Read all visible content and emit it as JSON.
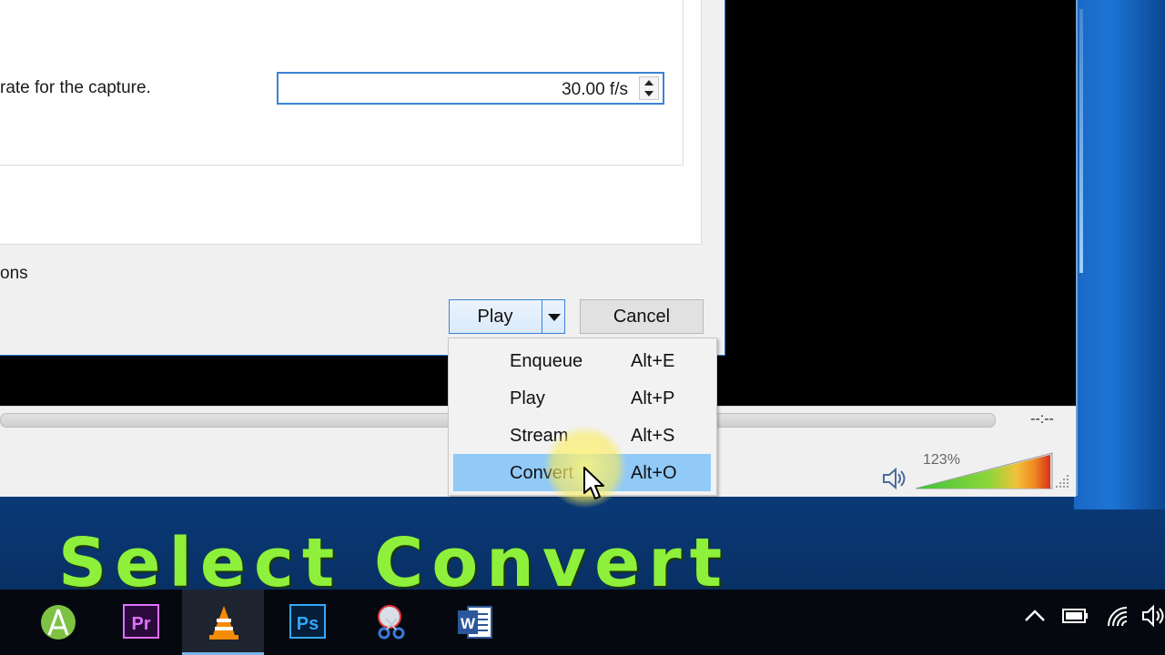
{
  "dialog": {
    "fps_label": "rate for the capture.",
    "fps_value": "30.00 f/s",
    "options_label": "ons",
    "play_label": "Play",
    "cancel_label": "Cancel"
  },
  "menu": {
    "items": [
      {
        "label": "Enqueue",
        "shortcut": "Alt+E"
      },
      {
        "label": "Play",
        "shortcut": "Alt+P"
      },
      {
        "label": "Stream",
        "shortcut": "Alt+S"
      },
      {
        "label": "Convert",
        "shortcut": "Alt+O",
        "highlighted": true
      }
    ]
  },
  "player": {
    "time": "--:--",
    "volume": "123%",
    "volume_level": 1.23
  },
  "caption": "Select Convert",
  "taskbar": {
    "apps": [
      {
        "icon": "android-studio-icon"
      },
      {
        "icon": "premiere-pro-icon",
        "text": "Pr"
      },
      {
        "icon": "vlc-icon",
        "active": true
      },
      {
        "icon": "photoshop-icon",
        "text": "Ps"
      },
      {
        "icon": "snipping-tool-icon"
      },
      {
        "icon": "word-icon",
        "text": "W"
      }
    ],
    "tray": [
      "chevron-up-icon",
      "battery-icon",
      "wifi-icon",
      "speaker-icon"
    ]
  },
  "colors": {
    "caption": "#8ef03a",
    "menu_highlight": "#91c9f7",
    "accent_border": "#3b82d6"
  }
}
